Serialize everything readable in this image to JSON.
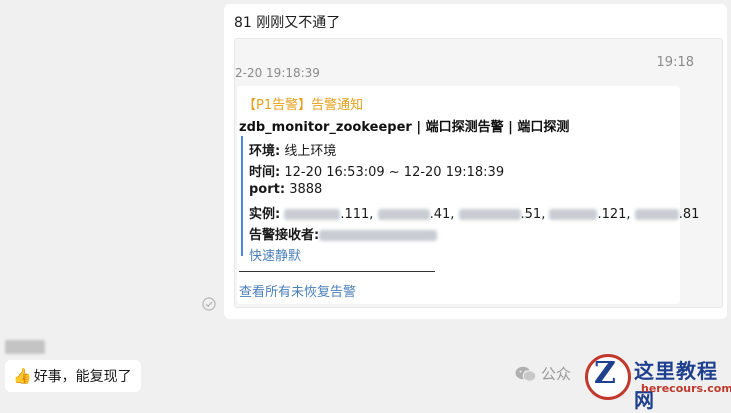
{
  "message": {
    "title": "81 刚刚又不通了"
  },
  "quote": {
    "time_right": "19:18",
    "time_left": "2-20 19:18:39",
    "card": {
      "tag": "【P1告警】告警通知",
      "title": "zdb_monitor_zookeeper | 端口探测告警 | 端口探测",
      "env_label": "环境:",
      "env_value": "线上环境",
      "time_label": "时间:",
      "time_value": "12-20 16:53:09 ~ 12-20 19:18:39",
      "port_label": "port:",
      "port_value": "3888",
      "inst_label": "实例:",
      "inst_suffixes": [
        ".111,",
        ".41,",
        ".51,",
        ".121,",
        ".81"
      ],
      "receiver_label": "告警接收者:",
      "mute_link": "快速静默",
      "bottom_link": "查看所有未恢复告警"
    }
  },
  "reply": {
    "text": "好事，能复现了"
  },
  "watermark": {
    "text": "公众"
  },
  "logo": {
    "cn": "这里教程网",
    "en": "herecours.com"
  },
  "colors": {
    "background": "#f0f0f0",
    "tag": "#e6a01c",
    "link": "#4a7fb8",
    "accent_bar": "#4a8be0"
  }
}
